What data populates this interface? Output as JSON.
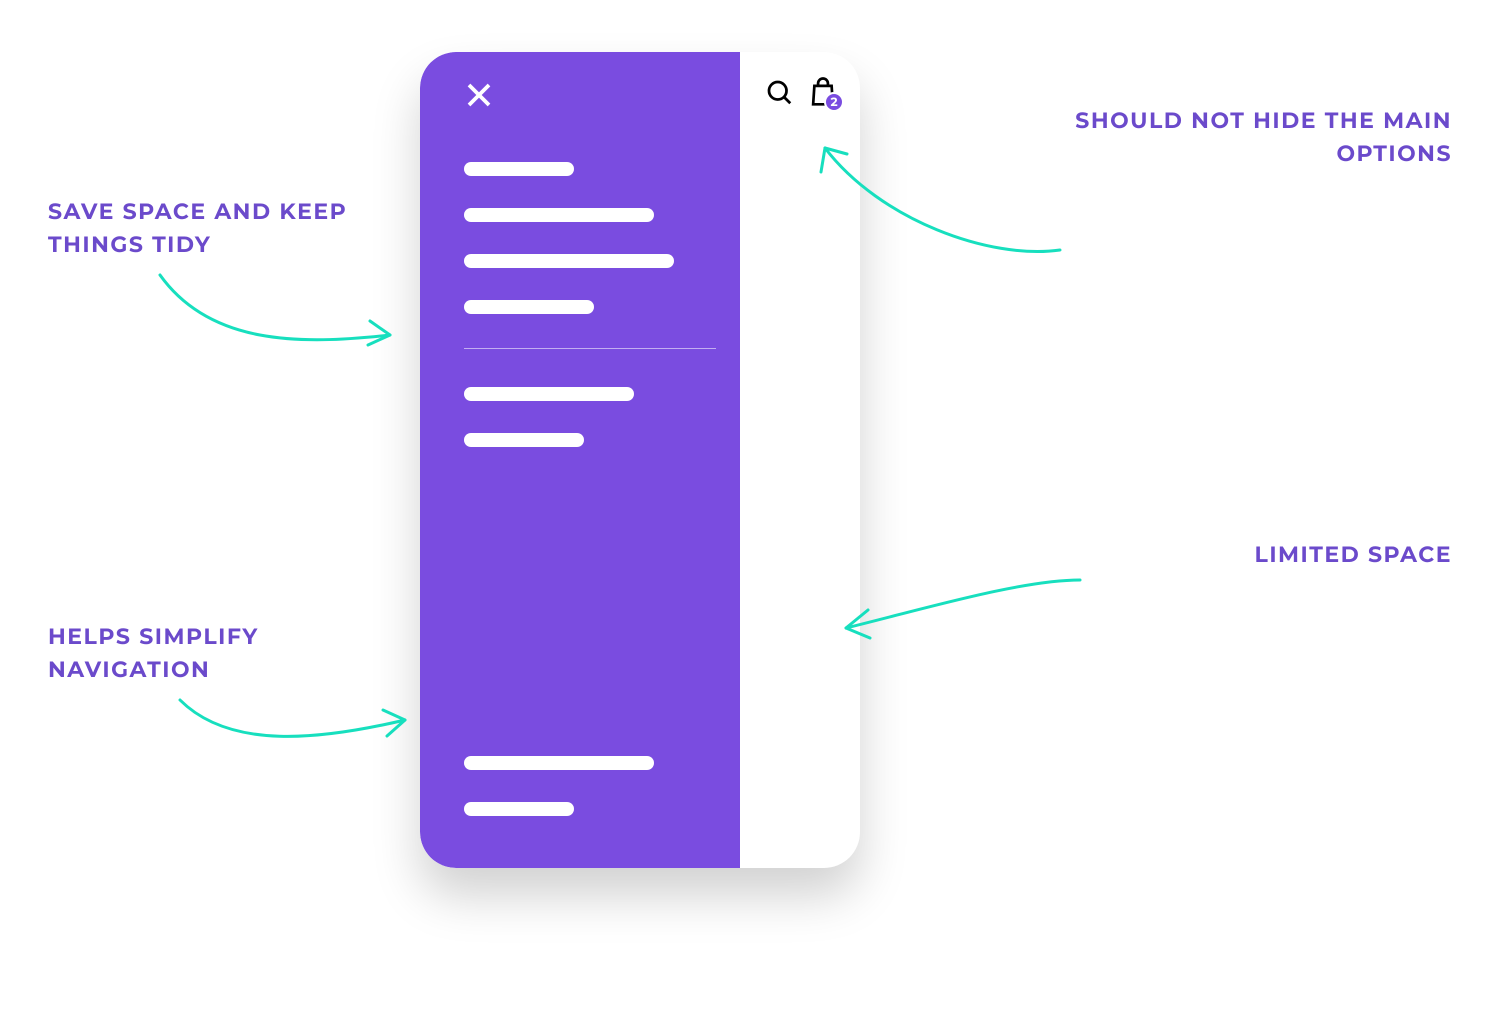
{
  "colors": {
    "accent": "#7A4CE0",
    "annotation_text": "#6B4ACB",
    "arrow": "#17DFBE"
  },
  "annotations": {
    "save_space": "SAVE SPACE AND KEEP THINGS TIDY",
    "simplify": "HELPS SIMPLIFY NAVIGATION",
    "not_hide": "SHOULD NOT HIDE THE MAIN OPTIONS",
    "limited": "LIMITED SPACE"
  },
  "phone": {
    "cart_badge": "2",
    "icons": {
      "close": "close-icon",
      "search": "search-icon",
      "cart": "shopping-bag-icon"
    }
  }
}
